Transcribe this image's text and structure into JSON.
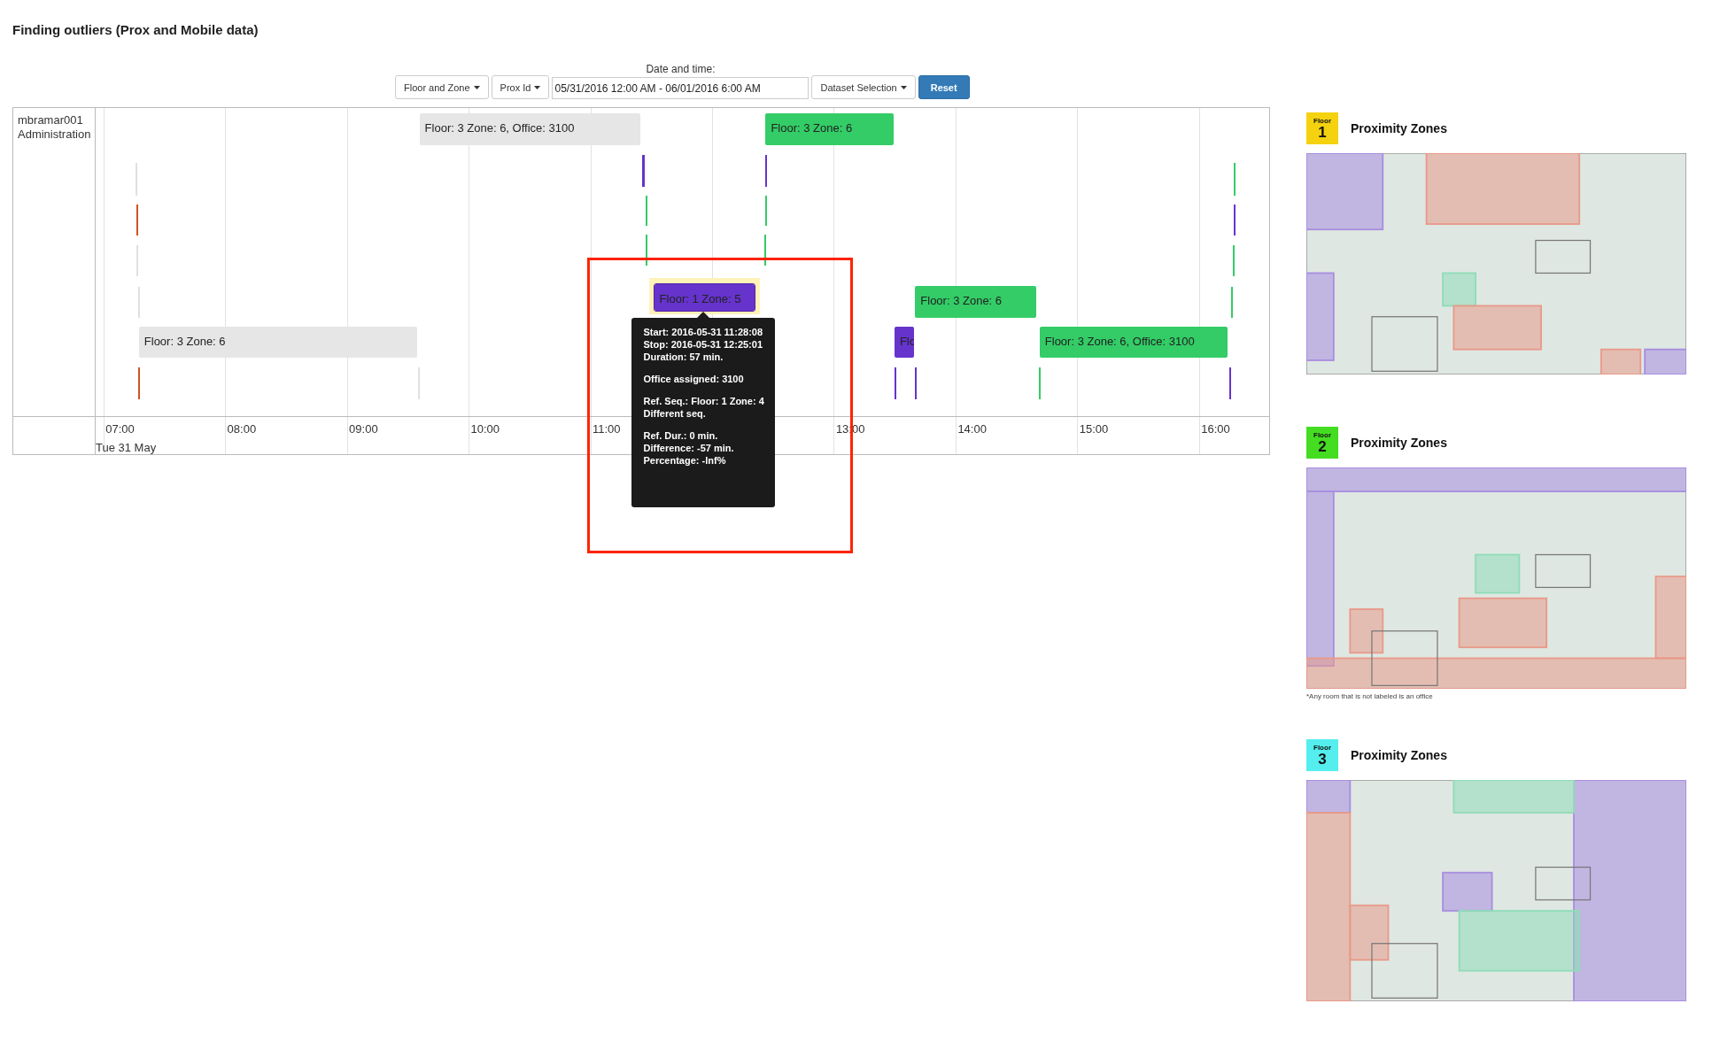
{
  "title": "Finding outliers (Prox and Mobile data)",
  "toolbar": {
    "date_label": "Date and time:",
    "dropdowns": [
      "Floor and Zone",
      "Prox Id"
    ],
    "date_value": "05/31/2016 12:00 AM - 06/01/2016 6:00 AM",
    "dataset_dropdown": "Dataset Selection",
    "reset_button": "Reset"
  },
  "timeline": {
    "person": [
      "mbramar001",
      "Administration"
    ],
    "bars": [
      {
        "label": "Floor: 3 Zone: 6, Office: 3100",
        "color": "#e6e6e6",
        "selected": false
      },
      {
        "label": "Floor: 3 Zone: 6",
        "color": "#33cc66",
        "selected": false
      },
      {
        "label": "Floor: 1 Zone: 5",
        "color": "#6633cc",
        "selected": true
      },
      {
        "label": "Floor: 3 Zone: 6",
        "color": "#33cc66",
        "selected": false
      },
      {
        "label": "Floor: 3 Zone: 6",
        "color": "#e6e6e6",
        "selected": false
      },
      {
        "label": "Flo",
        "color": "#6633cc",
        "selected": false
      },
      {
        "label": "Floor: 3 Zone: 6, Office: 3100",
        "color": "#33cc66",
        "selected": false
      }
    ],
    "markers": [
      {
        "color": "#e0e0e0"
      },
      {
        "color": "#6633cc"
      },
      {
        "color": "#6633cc"
      },
      {
        "color": "#33cc66"
      },
      {
        "color": "#cc5522"
      },
      {
        "color": "#33cc66"
      },
      {
        "color": "#33cc66"
      },
      {
        "color": "#6633cc"
      },
      {
        "color": "#e0e0e0"
      },
      {
        "color": "#33cc66"
      },
      {
        "color": "#33cc66"
      },
      {
        "color": "#33cc66"
      },
      {
        "color": "#e0e0e0"
      },
      {
        "color": "#33cc66"
      },
      {
        "color": "#cc5522"
      },
      {
        "color": "#e0e0e0"
      },
      {
        "color": "#6633cc"
      },
      {
        "color": "#6633cc"
      },
      {
        "color": "#33cc66"
      },
      {
        "color": "#6633cc"
      }
    ],
    "hours": [
      "07:00",
      "08:00",
      "09:00",
      "10:00",
      "11:00",
      "13:00",
      "14:00",
      "15:00",
      "16:00"
    ],
    "date": "Tue 31 May",
    "tooltip": [
      [
        "Start: 2016-05-31 11:28:08",
        "Stop: 2016-05-31 12:25:01",
        "Duration: 57 min."
      ],
      [
        "Office assigned: 3100"
      ],
      [
        "Ref. Seq.: Floor: 1 Zone: 4",
        "Different seq."
      ],
      [
        "Ref. Dur.: 0 min.",
        "Difference: -57 min.",
        "Percentage: -Inf%"
      ]
    ]
  },
  "floors": [
    {
      "badge_label": "Floor",
      "number": "1",
      "color": "#f5d20f",
      "title": "Proximity Zones"
    },
    {
      "badge_label": "Floor",
      "number": "2",
      "color": "#44dd22",
      "title": "Proximity Zones",
      "note": "*Any room that is not labeled is an office"
    },
    {
      "badge_label": "Floor",
      "number": "3",
      "color": "#55eeee",
      "title": "Proximity Zones"
    }
  ]
}
